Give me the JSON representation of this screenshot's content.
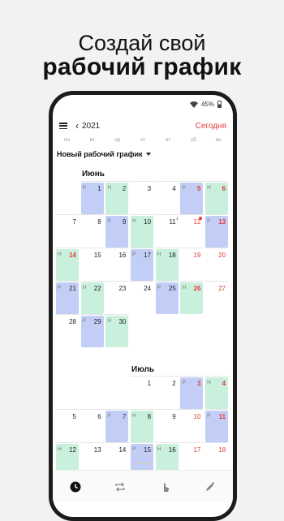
{
  "promo": {
    "line1": "Создай свой",
    "line2": "рабочий график"
  },
  "status": {
    "battery": "45%"
  },
  "header": {
    "year": "2021",
    "today_label": "Сегодня"
  },
  "weekdays": [
    "пн",
    "вт",
    "ср",
    "чт",
    "пт",
    "сб",
    "вс"
  ],
  "schedule_name": "Новый рабочий график",
  "months": [
    {
      "name": "Июнь",
      "days": [
        {
          "d": "1",
          "t": "Р"
        },
        {
          "d": "2",
          "t": "Н"
        },
        {
          "d": "3"
        },
        {
          "d": "4"
        },
        {
          "d": "5",
          "t": "Р",
          "red": true
        },
        {
          "d": "6",
          "t": "Н",
          "red": true
        },
        {
          "d": "7"
        },
        {
          "d": "8"
        },
        {
          "d": "9",
          "t": "Р"
        },
        {
          "d": "10",
          "t": "Н"
        },
        {
          "d": "11",
          "sup": "1"
        },
        {
          "d": "12",
          "wk": true,
          "dot": true
        },
        {
          "d": "13",
          "t": "Р",
          "red": true
        },
        {
          "d": "14",
          "t": "Н",
          "red": true
        },
        {
          "d": "15"
        },
        {
          "d": "16"
        },
        {
          "d": "17",
          "t": "Р"
        },
        {
          "d": "18",
          "t": "Н"
        },
        {
          "d": "19",
          "wk": true
        },
        {
          "d": "20",
          "wk": true
        },
        {
          "d": "21",
          "t": "Р"
        },
        {
          "d": "22",
          "t": "Н"
        },
        {
          "d": "23"
        },
        {
          "d": "24"
        },
        {
          "d": "25",
          "t": "Р"
        },
        {
          "d": "26",
          "t": "Н",
          "red": true
        },
        {
          "d": "27",
          "wk": true
        },
        {
          "d": "28"
        },
        {
          "d": "29",
          "t": "Р"
        },
        {
          "d": "30",
          "t": "Н"
        }
      ]
    },
    {
      "name": "Июль",
      "days": [
        {
          "d": "1"
        },
        {
          "d": "2"
        },
        {
          "d": "3",
          "t": "Р",
          "red": true
        },
        {
          "d": "4",
          "t": "Н",
          "red": true
        },
        {
          "d": "5"
        },
        {
          "d": "6"
        },
        {
          "d": "7",
          "t": "Р"
        },
        {
          "d": "8",
          "t": "Н"
        },
        {
          "d": "9"
        },
        {
          "d": "10",
          "wk": true
        },
        {
          "d": "11",
          "t": "Р",
          "red": true
        },
        {
          "d": "12",
          "t": "Н"
        },
        {
          "d": "13"
        },
        {
          "d": "14"
        },
        {
          "d": "15",
          "t": "Р"
        },
        {
          "d": "16",
          "t": "Н"
        },
        {
          "d": "17",
          "wk": true
        },
        {
          "d": "18",
          "wk": true
        }
      ]
    }
  ],
  "nav": [
    {
      "name": "clock-icon"
    },
    {
      "name": "repeat-icon"
    },
    {
      "name": "touch-icon"
    },
    {
      "name": "edit-icon"
    }
  ],
  "colors": {
    "work": "#c3cef6",
    "off": "#c9f0dd",
    "accent": "#e53935"
  }
}
